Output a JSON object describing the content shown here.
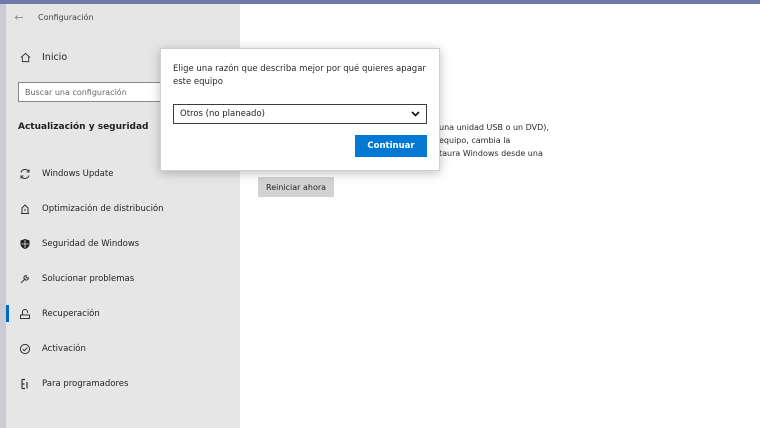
{
  "window": {
    "title": "Configuración"
  },
  "sidebar": {
    "home": {
      "label": "Inicio",
      "icon": "home-icon"
    },
    "search": {
      "placeholder": "Buscar una configuración"
    },
    "section_title": "Actualización y seguridad",
    "items": [
      {
        "label": "Windows Update",
        "icon": "refresh-icon",
        "active": false
      },
      {
        "label": "Optimización de distribución",
        "icon": "delivery-optimization-icon",
        "active": false
      },
      {
        "label": "Seguridad de Windows",
        "icon": "shield-icon",
        "active": false
      },
      {
        "label": "Solucionar problemas",
        "icon": "wrench-icon",
        "active": false
      },
      {
        "label": "Recuperación",
        "icon": "recovery-icon",
        "active": true
      },
      {
        "label": "Activación",
        "icon": "check-circle-icon",
        "active": false
      },
      {
        "label": "Para programadores",
        "icon": "developer-icon",
        "active": false
      }
    ]
  },
  "main": {
    "partial_lines": [
      "una unidad USB o un DVD),",
      "equipo, cambia la",
      "taura Windows desde una"
    ],
    "restart_label": "Reiniciar ahora"
  },
  "dialog": {
    "prompt": "Elige una razón que describa mejor por qué quieres apagar este equipo",
    "selected": "Otros (no planeado)",
    "continue_label": "Continuar"
  },
  "colors": {
    "accent": "#0078d4",
    "sidebar_bg": "#e6e6e6"
  }
}
